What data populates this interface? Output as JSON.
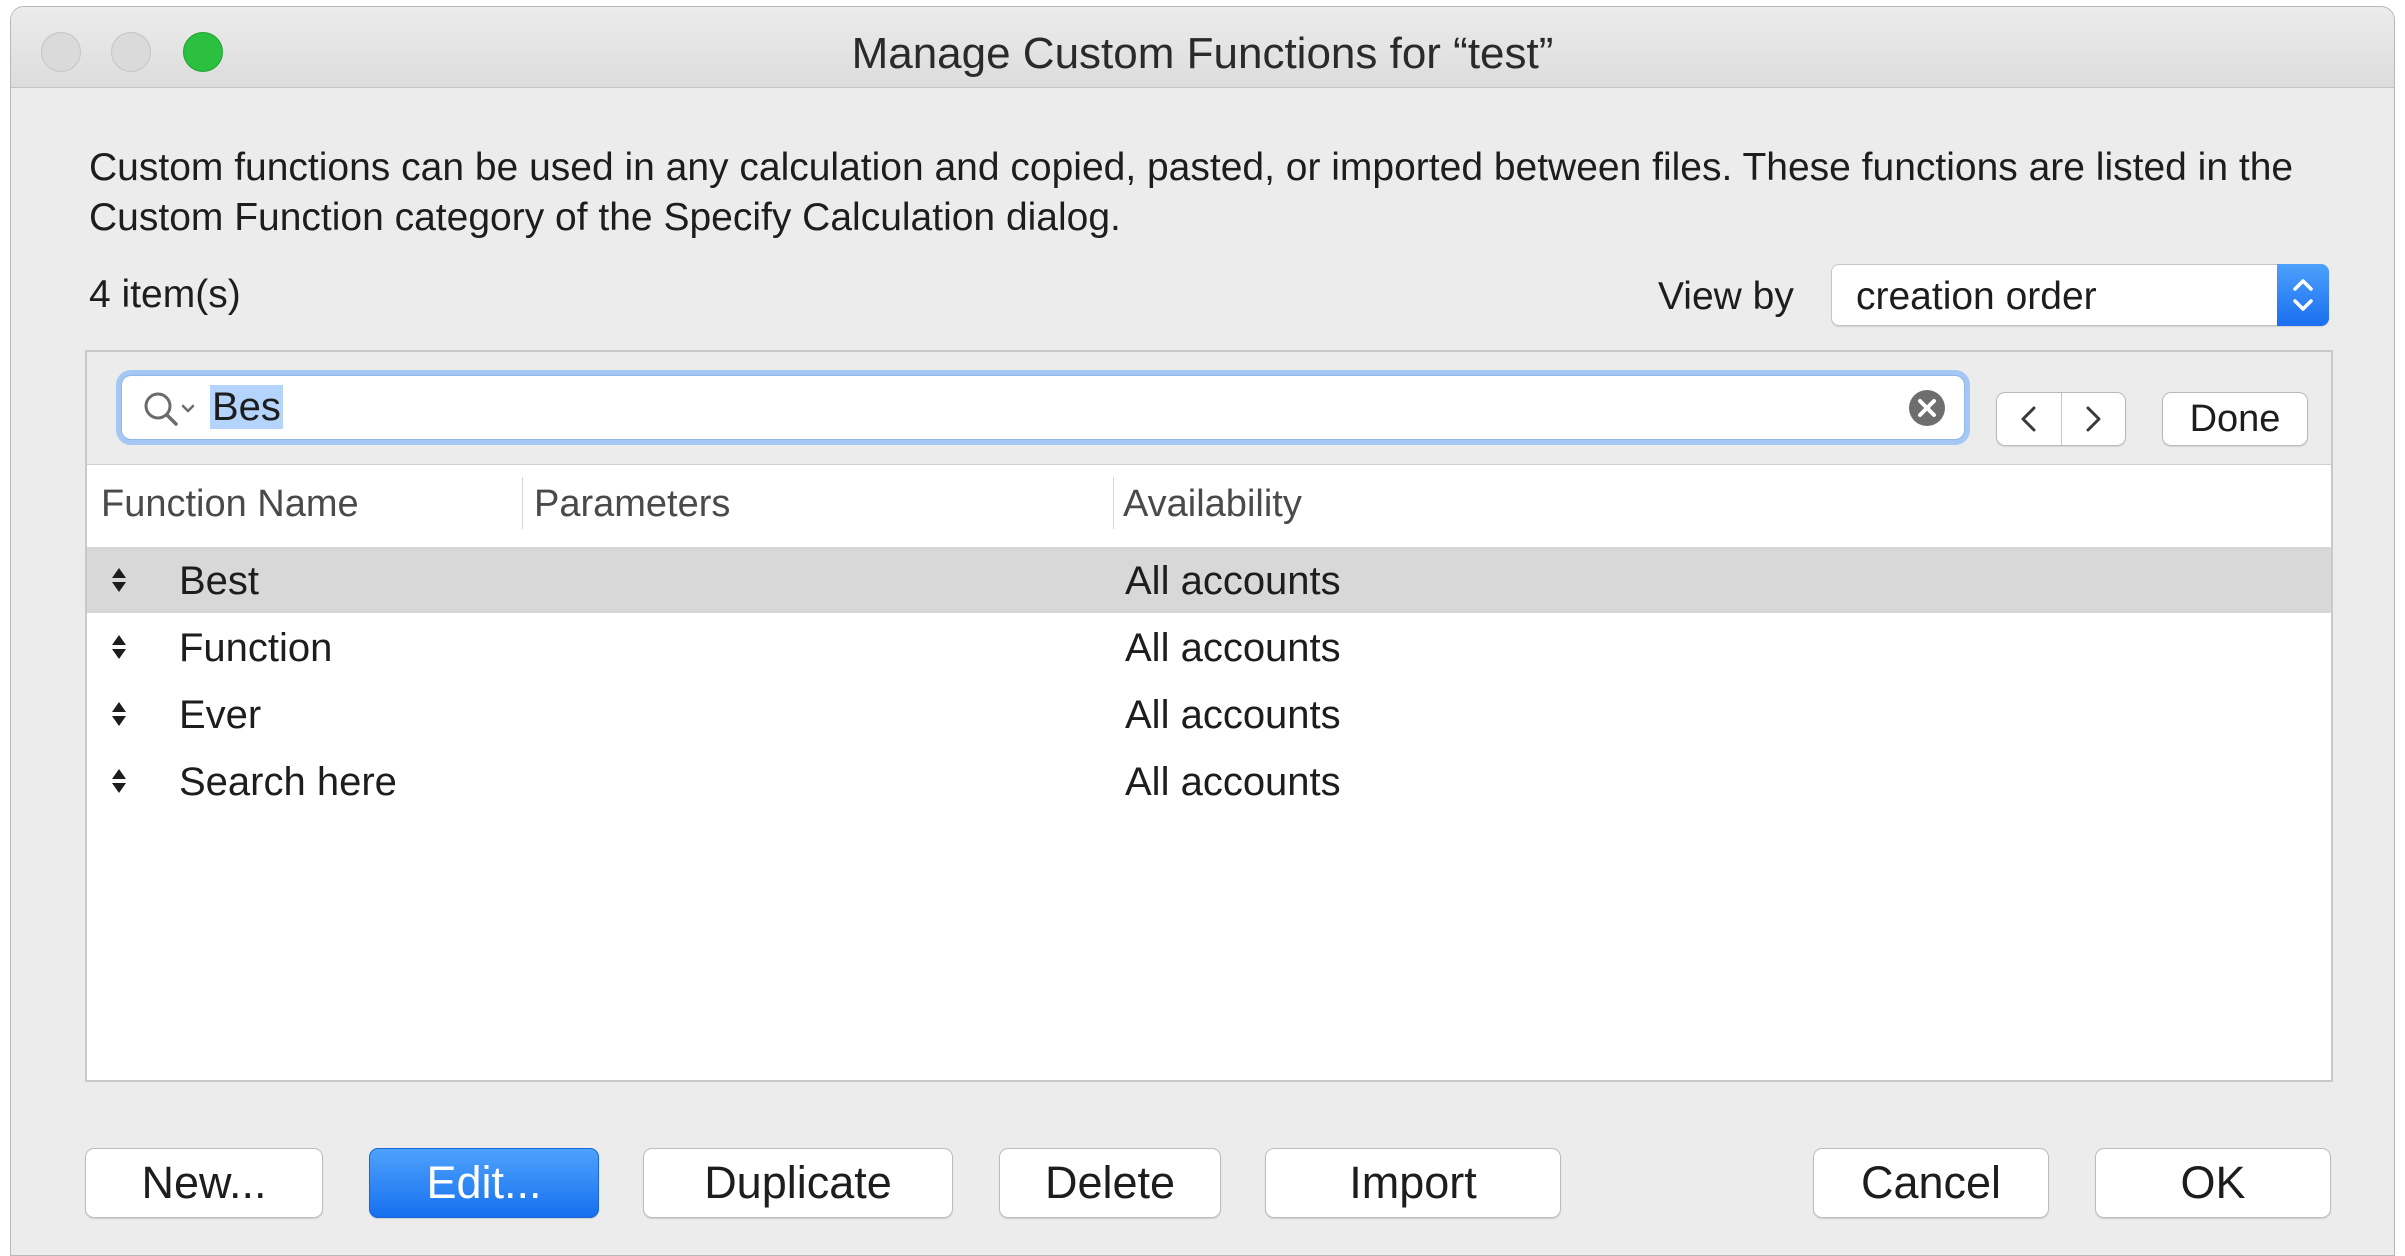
{
  "window": {
    "title": "Manage Custom Functions for “test”"
  },
  "description": "Custom functions can be used in any calculation and copied, pasted, or imported between files. These functions are listed in the Custom Function category of the Specify Calculation dialog.",
  "item_count": "4 item(s)",
  "view_by": {
    "label": "View by",
    "selected": "creation order"
  },
  "find_bar": {
    "search_value": "Bes",
    "done_label": "Done"
  },
  "table": {
    "columns": [
      "Function Name",
      "Parameters",
      "Availability"
    ],
    "rows": [
      {
        "name": "Best",
        "parameters": "",
        "availability": "All accounts"
      },
      {
        "name": "Function",
        "parameters": "",
        "availability": "All accounts"
      },
      {
        "name": "Ever",
        "parameters": "",
        "availability": "All accounts"
      },
      {
        "name": "Search here",
        "parameters": "",
        "availability": "All accounts"
      }
    ]
  },
  "buttons": {
    "new": "New...",
    "edit": "Edit...",
    "duplicate": "Duplicate",
    "delete": "Delete",
    "import": "Import",
    "cancel": "Cancel",
    "ok": "OK"
  },
  "icons": {
    "search": "search-icon",
    "clear": "clear-search-icon",
    "prev": "chevron-left-icon",
    "next": "chevron-right-icon",
    "row_handle": "drag-handle-icon",
    "select_arrows": "up-down-chevron-icon"
  },
  "colors": {
    "accent": "#1670ef",
    "selection_row": "#d8d8d8",
    "search_highlight": "#b5d4fb",
    "zoom_button": "#2bc03f"
  }
}
